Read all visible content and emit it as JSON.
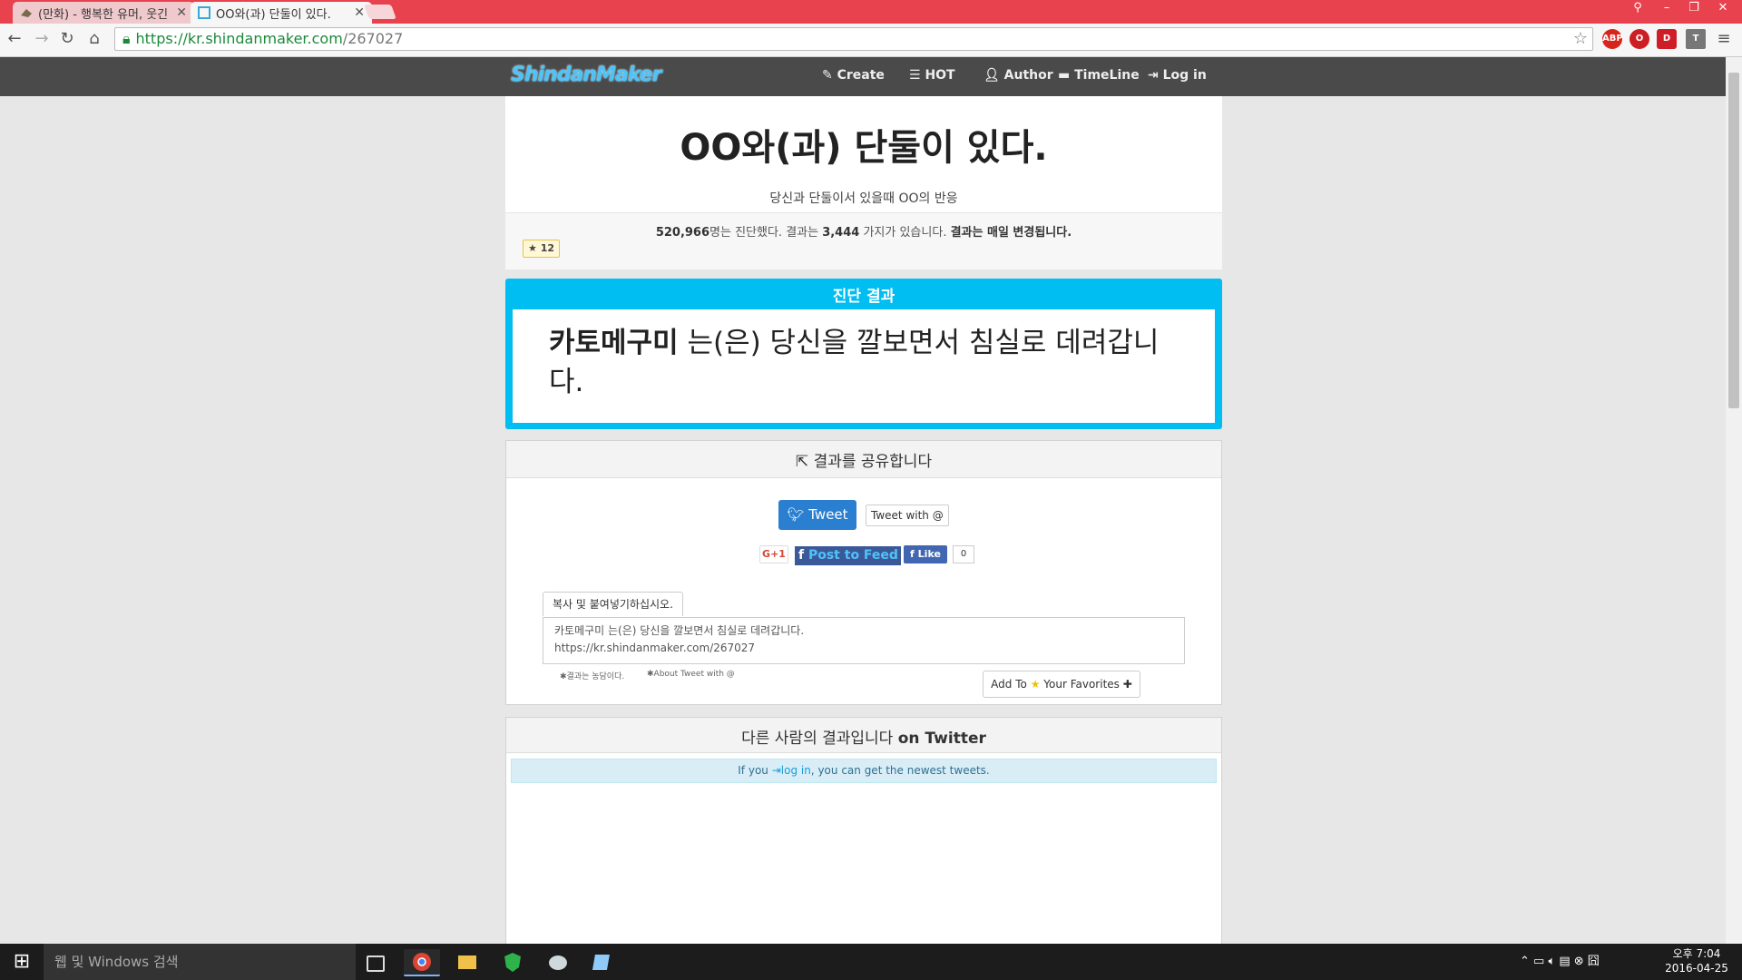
{
  "browser": {
    "tabs": [
      {
        "title": "(만화) - 행복한 유머, 웃긴",
        "active": false
      },
      {
        "title": "OO와(과) 단둘이 있다.",
        "active": true
      }
    ],
    "url_host": "https://kr.shindanmaker.com",
    "url_path": "/267027",
    "extensions": [
      "ABP",
      "O",
      "D",
      "T"
    ]
  },
  "site": {
    "logo": "ShindanMaker",
    "nav": [
      "Create",
      "HOT",
      "Author",
      "TimeLine",
      "Log in"
    ]
  },
  "hero": {
    "title": "OO와(과) 단둘이 있다.",
    "subtitle": "당신과 단둘이서 있을때 OO의 반응",
    "count": "520,966",
    "stats_a": "명는 진단했다. 결과는 ",
    "results": "3,444",
    "stats_b": " 가지가 있습니다. ",
    "stats_c": "결과는 매일 변경됩니다.",
    "stars": "★ 12"
  },
  "result": {
    "header": "진단 결과",
    "name": "카토메구미",
    "text": " 는(은) 당신을 깔보면서 침실로 데려갑니다."
  },
  "share": {
    "title": "결과를 공유합니다",
    "tweet": "Tweet",
    "tweet_with": "Tweet with @",
    "gplus": "G+1",
    "post_feed": "Post to Feed",
    "like": "Like",
    "like_count": "0",
    "copy_tab": "복사 및 붙여넣기하십시오.",
    "copy_text": "카토메구미 는(은) 당신을 깔보면서 침실로 데려갑니다.\nhttps://kr.shindanmaker.com/267027",
    "note1": "✱결과는 농담이다.",
    "note2": "✱About Tweet with @",
    "fav_a": "Add To",
    "fav_star": "★",
    "fav_b": "Your Favorites",
    "fav_plus": "✚"
  },
  "twitter": {
    "title_a": "다른 사람의 결과입니다 ",
    "title_b": "on Twitter",
    "info_a": "If you ",
    "info_login": "log in",
    "info_b": ", you can get the newest tweets."
  },
  "taskbar": {
    "search": "웹 및 Windows 검색",
    "time": "오후 7:04",
    "date": "2016-04-25"
  },
  "colors": {
    "titlebar": "#e8424e",
    "navbar": "#4a4a4a",
    "result_accent": "#00bdf2",
    "tweet_blue": "#2b7fd0"
  }
}
